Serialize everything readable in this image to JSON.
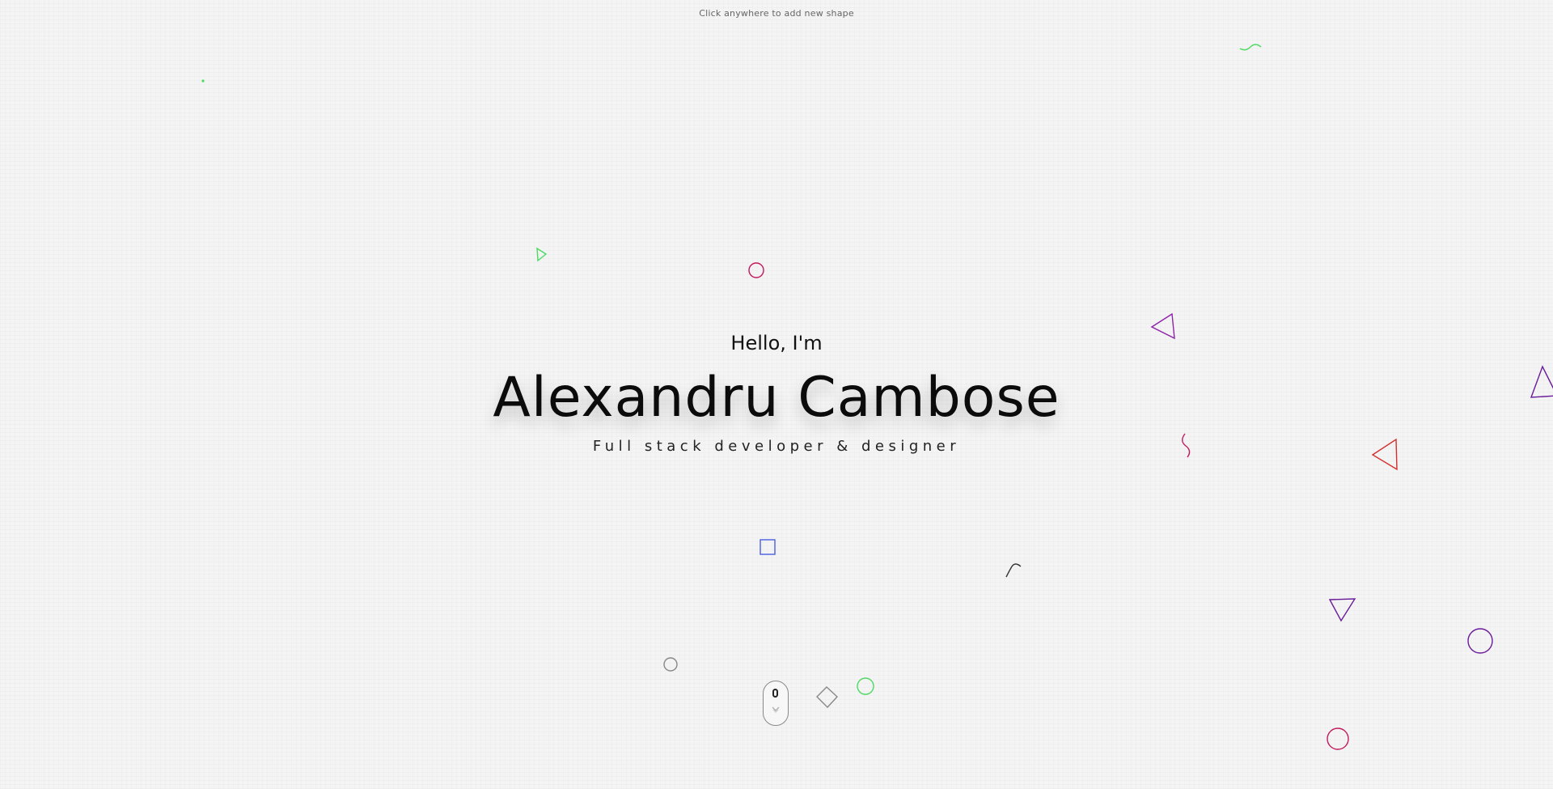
{
  "hint": {
    "text": "Click anywhere to add new shape"
  },
  "hero": {
    "greeting": "Hello, I'm",
    "name": "Alexandru Cambose",
    "role": "Full stack developer & designer"
  },
  "scroll_indicator": {
    "icon": "mouse-scroll-icon"
  },
  "colors": {
    "background": "#f4f4f4",
    "text": "#0b0b0b",
    "shape_pink": "#c2185b",
    "shape_purple": "#6a1b9a",
    "shape_red": "#d32f2f",
    "shape_green": "#4cd964",
    "shape_blue": "#4a5fe0",
    "shape_gray": "#888888",
    "shape_dark": "#333333"
  },
  "shapes": [
    {
      "kind": "circle",
      "color": "#c2185b"
    },
    {
      "kind": "triangle",
      "color": "#4cd964"
    },
    {
      "kind": "triangle",
      "color": "#8e24aa"
    },
    {
      "kind": "triangle",
      "color": "#6a1b9a"
    },
    {
      "kind": "squiggle",
      "color": "#c2185b"
    },
    {
      "kind": "triangle",
      "color": "#d32f2f"
    },
    {
      "kind": "square",
      "color": "#4a5fe0"
    },
    {
      "kind": "squiggle",
      "color": "#333333"
    },
    {
      "kind": "triangle",
      "color": "#6a1b9a"
    },
    {
      "kind": "circle",
      "color": "#6a1b9a"
    },
    {
      "kind": "circle",
      "color": "#888888"
    },
    {
      "kind": "circle",
      "color": "#4cd964"
    },
    {
      "kind": "diamond",
      "color": "#888888"
    },
    {
      "kind": "circle",
      "color": "#c2185b"
    },
    {
      "kind": "squiggle",
      "color": "#4cd964"
    },
    {
      "kind": "dot",
      "color": "#4cd964"
    }
  ]
}
